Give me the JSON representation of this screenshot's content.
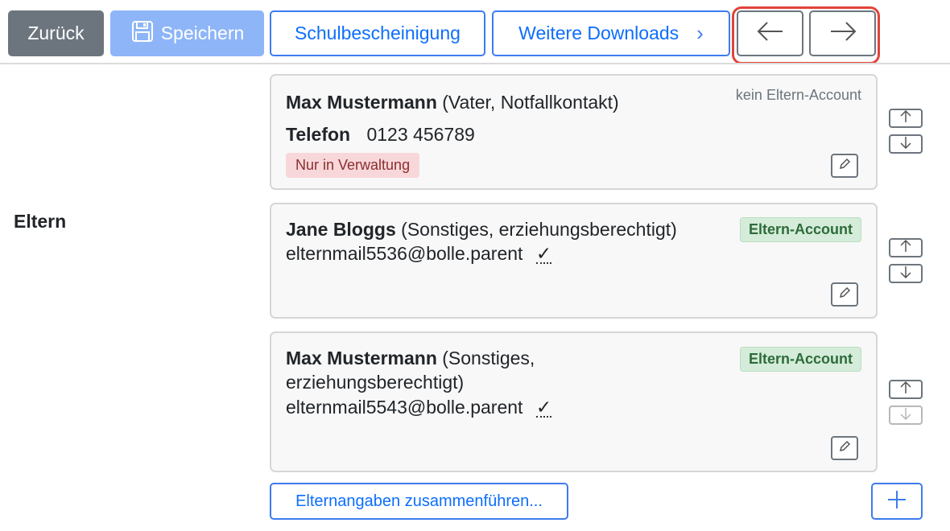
{
  "toolbar": {
    "back_label": "Zurück",
    "save_label": "Speichern",
    "certificate_label": "Schulbescheinigung",
    "downloads_label": "Weitere Downloads",
    "downloads_chevron": "›",
    "prev_icon": "arrow-left-icon",
    "next_icon": "arrow-right-icon"
  },
  "section": {
    "label": "Eltern"
  },
  "parents": [
    {
      "name": "Max Mustermann",
      "detail": "(Vater, Notfallkontakt)",
      "account_status": "kein Eltern-Account",
      "phone_label": "Telefon",
      "phone": "0123 456789",
      "tag": "Nur in Verwaltung"
    },
    {
      "name": "Jane Bloggs",
      "detail": "(Sonstiges, erziehungsberechtigt)",
      "account_status": "Eltern-Account",
      "email": "elternmail5536@bolle.parent",
      "verified_mark": "✓"
    },
    {
      "name": "Max Mustermann",
      "detail": "(Sonstiges,",
      "detail_line2": "erziehungsberechtigt)",
      "account_status": "Eltern-Account",
      "email": "elternmail5543@bolle.parent",
      "verified_mark": "✓"
    }
  ],
  "actions": {
    "merge_label": "Elternangaben zusammenführen...",
    "add_icon": "plus-icon"
  },
  "colors": {
    "primary": "#0d6efd",
    "secondary": "#6c757d",
    "highlight": "#e2433a",
    "success_badge": "#d4ecd9",
    "danger_badge": "#f8d7da"
  }
}
